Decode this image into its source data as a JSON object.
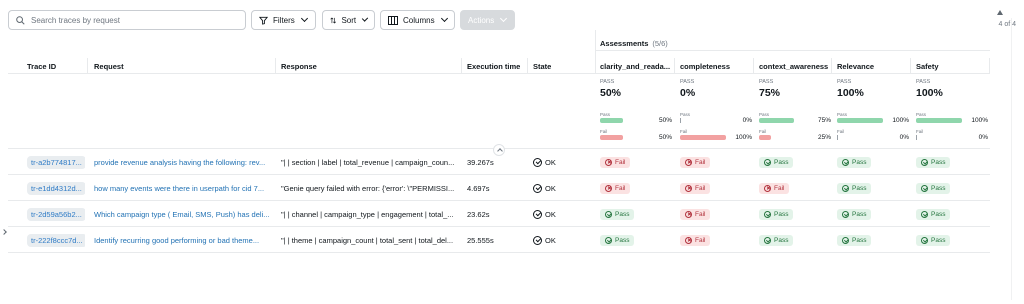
{
  "search": {
    "placeholder": "Search traces by request",
    "icon": "search-icon"
  },
  "toolbar": {
    "filters_label": "Filters",
    "sort_label": "Sort",
    "columns_label": "Columns",
    "actions_label": "Actions"
  },
  "pagination": {
    "count_text": "4 of 4"
  },
  "assessments": {
    "title": "Assessments",
    "count": "(5/6)"
  },
  "columns": {
    "trace_id": "Trace ID",
    "request": "Request",
    "response": "Response",
    "execution_time": "Execution time",
    "state": "State",
    "assessments": [
      "clarity_and_reada...",
      "completeness",
      "context_awareness",
      "Relevance",
      "Safety"
    ]
  },
  "summaries": [
    {
      "label": "PASS",
      "pct": "50%",
      "pass_label": "Pass",
      "pass_value": 50,
      "pass_text": "50%",
      "fail_label": "Fail",
      "fail_value": 50,
      "fail_text": "50%"
    },
    {
      "label": "PASS",
      "pct": "0%",
      "pass_label": "Pass",
      "pass_value": 0,
      "pass_text": "0%",
      "fail_label": "Fail",
      "fail_value": 100,
      "fail_text": "100%"
    },
    {
      "label": "PASS",
      "pct": "75%",
      "pass_label": "Pass",
      "pass_value": 75,
      "pass_text": "75%",
      "fail_label": "Fail",
      "fail_value": 25,
      "fail_text": "25%"
    },
    {
      "label": "PASS",
      "pct": "100%",
      "pass_label": "Pass",
      "pass_value": 100,
      "pass_text": "100%",
      "fail_label": "Fail",
      "fail_value": 0,
      "fail_text": "0%"
    },
    {
      "label": "PASS",
      "pct": "100%",
      "pass_label": "Pass",
      "pass_value": 100,
      "pass_text": "100%",
      "fail_label": "Fail",
      "fail_value": 0,
      "fail_text": "0%"
    }
  ],
  "rows": [
    {
      "trace_id": "tr-a2b774817...",
      "request": "provide revenue analysis having the following: rev...",
      "response": "\"| | section | label | total_revenue | campaign_coun...",
      "execution_time": "39.267s",
      "state": "OK",
      "results": [
        "Fail",
        "Fail",
        "Pass",
        "Pass",
        "Pass"
      ]
    },
    {
      "trace_id": "tr-e1dd4312d...",
      "request": "how many events were there in userpath for cid 7...",
      "response": "\"Genie query failed with error: {'error': \\\"PERMISSI...",
      "execution_time": "4.697s",
      "state": "OK",
      "results": [
        "Fail",
        "Fail",
        "Fail",
        "Pass",
        "Pass"
      ]
    },
    {
      "trace_id": "tr-2d59a56b2...",
      "request": "Which campaign type ( Email, SMS, Push) has deli...",
      "response": "\"| | channel | campaign_type | engagement | total_...",
      "execution_time": "23.62s",
      "state": "OK",
      "results": [
        "Pass",
        "Fail",
        "Pass",
        "Pass",
        "Pass"
      ]
    },
    {
      "trace_id": "tr-222f8ccc7d...",
      "request": "Identify recurring good performing or bad theme...",
      "response": "\"| | theme | campaign_count | total_sent | total_del...",
      "execution_time": "25.555s",
      "state": "OK",
      "results": [
        "Pass",
        "Fail",
        "Pass",
        "Pass",
        "Pass"
      ]
    }
  ]
}
